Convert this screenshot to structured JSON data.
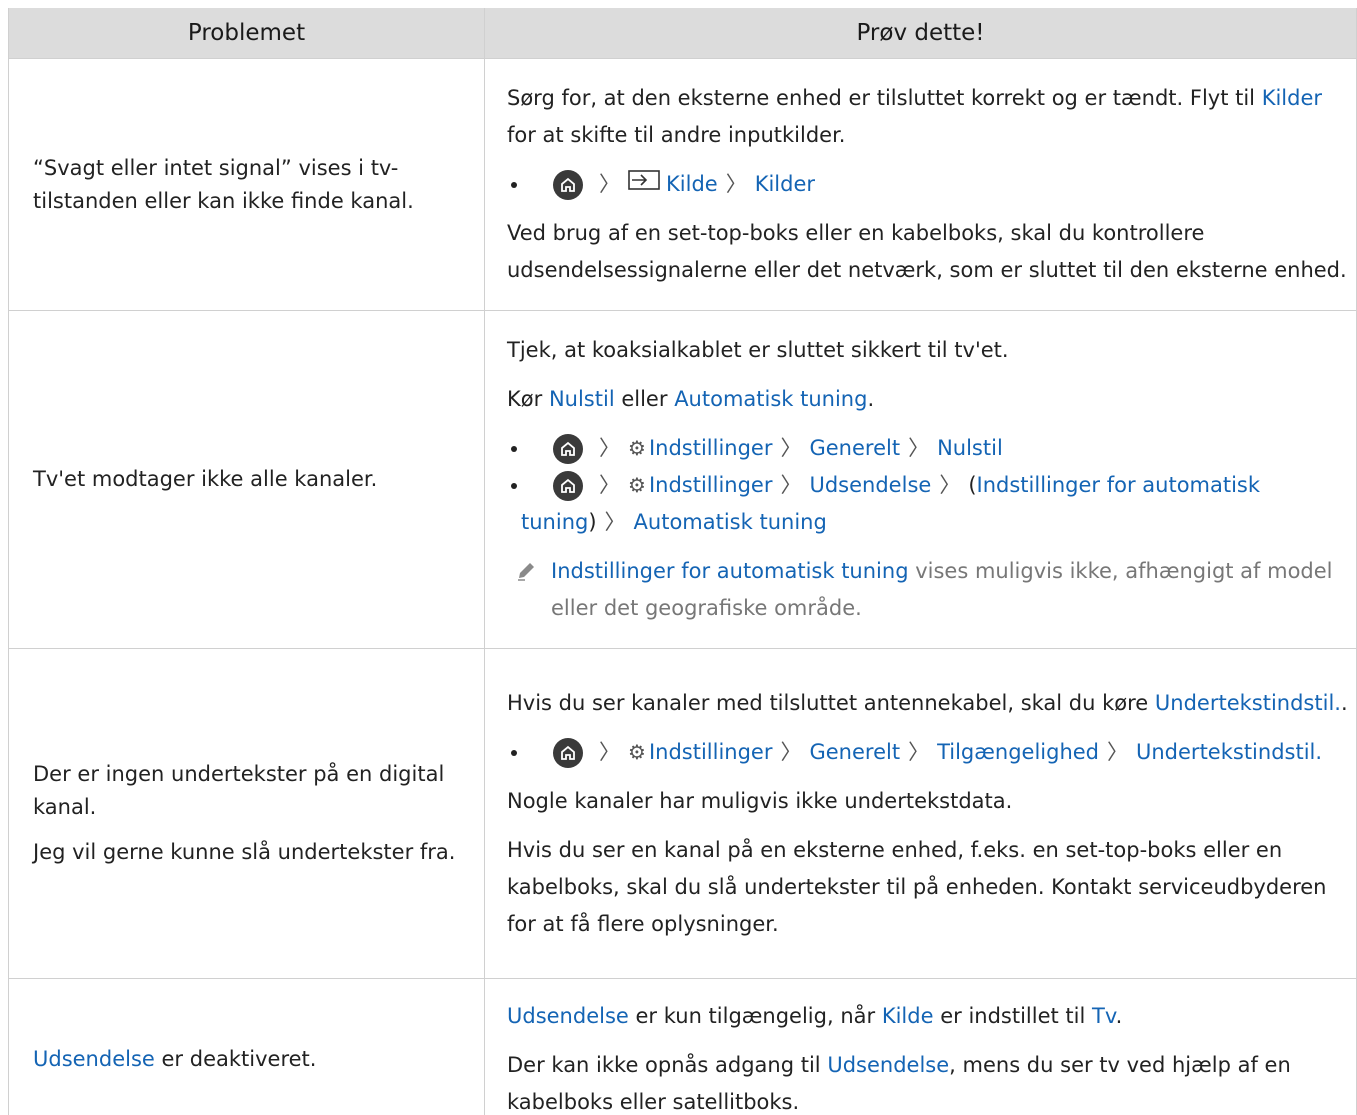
{
  "header": {
    "col1": "Problemet",
    "col2": "Prøv dette!"
  },
  "row1": {
    "problem": "“Svagt eller intet signal” vises i tv-tilstanden eller kan ikke finde kanal.",
    "p1_text": "Sørg for, at den eksterne enhed er tilsluttet korrekt og er tændt. Flyt til",
    "p1_link": "Kilder",
    "p1_text2": "for at skifte til andre inputkilder.",
    "path1": "Kilde",
    "path2": "Kilder",
    "p2": "Ved brug af en set-top-boks eller en kabelboks, skal du kontrollere udsendelsessignalerne eller det netværk, som er sluttet til den eksterne enhed."
  },
  "row2": {
    "problem": "Tv'et modtager ikke alle kanaler.",
    "p1": "Tjek, at koaksialkablet er sluttet sikkert til tv'et.",
    "p2_pre": "Kør",
    "p2_link1": "Nulstil",
    "p2_mid": "eller",
    "p2_link2": "Automatisk tuning",
    "p2_end": ".",
    "b1_1": "Indstillinger",
    "b1_2": "Generelt",
    "b1_3": "Nulstil",
    "b2_1": "Indstillinger",
    "b2_2": "Udsendelse",
    "b2_open": "(",
    "b2_3": "Indstillinger for automatisk tuning",
    "b2_close": ")",
    "b2_4": "Automatisk tuning",
    "note_link": "Indstillinger for automatisk tuning",
    "note_text": "vises muligvis ikke, afhængigt af model eller det geografiske område."
  },
  "row3": {
    "problem1": "Der er ingen undertekster på en digital kanal.",
    "problem2": "Jeg vil gerne kunne slå undertekster fra.",
    "p1_text": "Hvis du ser kanaler med tilsluttet antennekabel, skal du køre",
    "p1_link": "Undertekstindstil.",
    "p1_end": ".",
    "b1": "Indstillinger",
    "b2": "Generelt",
    "b3": "Tilgængelighed",
    "b4": "Undertekstindstil.",
    "p2": "Nogle kanaler har muligvis ikke undertekstdata.",
    "p3": "Hvis du ser en kanal på en eksterne enhed, f.eks. en set-top-boks eller en kabelboks, skal du slå undertekster til på enheden. Kontakt serviceudbyderen for at få flere oplysninger."
  },
  "row4": {
    "problem_link": "Udsendelse",
    "problem_text": "er deaktiveret.",
    "p1_link1": "Udsendelse",
    "p1_t1": "er kun tilgængelig, når",
    "p1_link2": "Kilde",
    "p1_t2": "er indstillet til",
    "p1_link3": "Tv",
    "p1_end": ".",
    "p2_t1": "Der kan ikke opnås adgang til",
    "p2_link": "Udsendelse",
    "p2_t2": ", mens du ser tv ved hjælp af en kabelboks eller satellitboks."
  }
}
